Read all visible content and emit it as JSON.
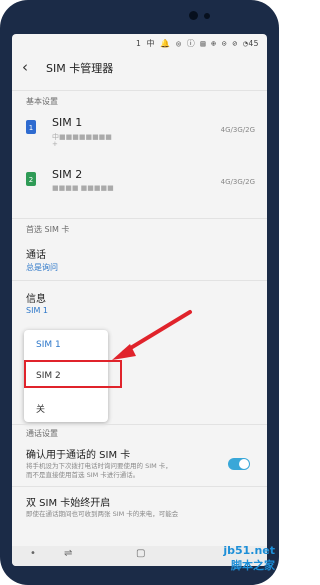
{
  "status": {
    "text": "1 中 🔔 ◎ ⓘ ▤ ⊕ ⊙ ⊘ ◔45"
  },
  "header": {
    "title": "SIM 卡管理器",
    "back_icon": "arrow-left-icon"
  },
  "sections": {
    "basic": "基本设置",
    "preferred": "首选 SIM 卡",
    "call": "通话设置"
  },
  "sims": [
    {
      "name": "SIM 1",
      "line1": "中■■■■■■■■",
      "line2": "+",
      "network": "4G/3G/2G",
      "badge": "1",
      "color": "#2e6bd0"
    },
    {
      "name": "SIM 2",
      "line1": "■■■■ ■■■■■",
      "line2": "",
      "network": "4G/3G/2G",
      "badge": "2",
      "color": "#2f9b56"
    }
  ],
  "preferred": [
    {
      "title": "通话",
      "value": "总是询问"
    },
    {
      "title": "信息",
      "value": "SIM 1"
    }
  ],
  "popup": {
    "options": [
      "SIM 1",
      "SIM 2",
      "关"
    ],
    "selected": "SIM 1",
    "highlighted": "SIM 2"
  },
  "call_settings": [
    {
      "title": "确认用于通话的 SIM 卡",
      "desc1": "将手机设为下次拨打电话时询问要使用的 SIM 卡，",
      "desc2": "而不是直接使用首选 SIM 卡进行通话。",
      "toggle_on": true
    },
    {
      "title": "双 SIM 卡始终开启",
      "desc1": "即使在通话期间也可收到两张 SIM 卡的来电，可能会"
    }
  ],
  "watermark": {
    "line1": "jb51.net",
    "line2": "脚本之家"
  },
  "colors": {
    "accent": "#2d77c9",
    "arrow": "#e0232b",
    "toggle": "#39a7d8"
  }
}
